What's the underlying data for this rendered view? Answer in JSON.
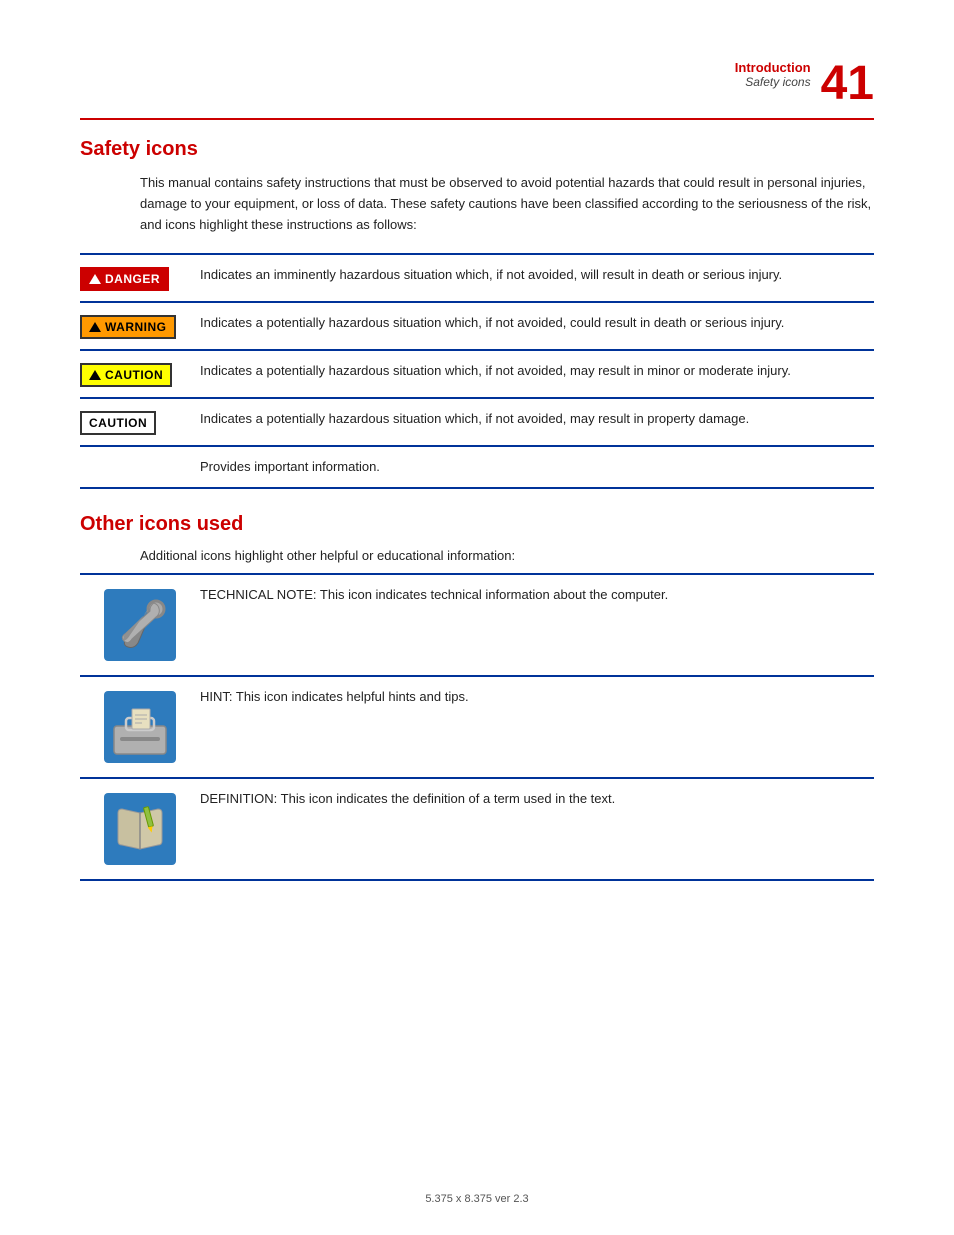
{
  "header": {
    "section": "Introduction",
    "subtitle": "Safety icons",
    "page_number": "41"
  },
  "safety_icons_section": {
    "title": "Safety icons",
    "intro": "This manual contains safety instructions that must be observed to avoid potential hazards that could result in personal injuries, damage to your equipment, or loss of data. These safety cautions have been classified according to the seriousness of the risk, and icons highlight these instructions as follows:",
    "rows": [
      {
        "badge_type": "danger",
        "badge_label": "DANGER",
        "text": "Indicates an imminently hazardous situation which, if not avoided, will result in death or serious injury."
      },
      {
        "badge_type": "warning",
        "badge_label": "WARNING",
        "text": "Indicates a potentially hazardous situation which, if not avoided, could result in death or serious injury."
      },
      {
        "badge_type": "caution_yellow",
        "badge_label": "CAUTION",
        "text": "Indicates a potentially hazardous situation which, if not avoided, may result in minor or moderate injury."
      },
      {
        "badge_type": "caution_white",
        "badge_label": "CAUTION",
        "text": "Indicates a potentially hazardous situation which, if not avoided, may result in property damage."
      },
      {
        "badge_type": "note",
        "badge_label": "",
        "text": "Provides important information."
      }
    ]
  },
  "other_icons_section": {
    "title": "Other icons used",
    "intro": "Additional icons highlight other helpful or educational information:",
    "rows": [
      {
        "icon_type": "wrench",
        "text": "TECHNICAL NOTE: This icon indicates technical information about the computer."
      },
      {
        "icon_type": "toolbox",
        "text": "HINT: This icon indicates helpful hints and tips."
      },
      {
        "icon_type": "book",
        "text": "DEFINITION: This icon indicates the definition of a term used in the text."
      }
    ]
  },
  "footer": {
    "text": "5.375 x 8.375 ver 2.3"
  }
}
